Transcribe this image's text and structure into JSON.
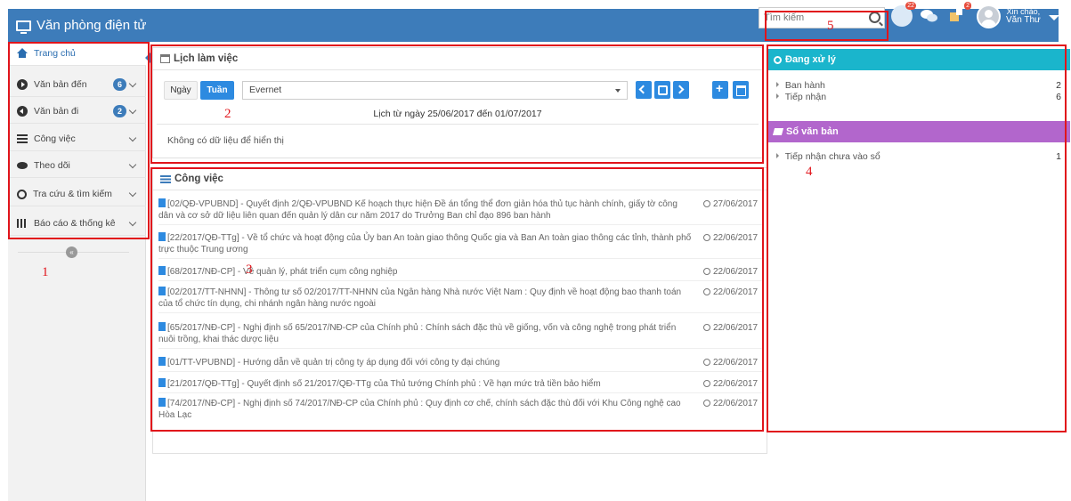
{
  "app": {
    "title": "Văn phòng điện tử",
    "brand_icon": "monitor-icon"
  },
  "header": {
    "search_placeholder": "Tìm kiếm",
    "notifications": [
      {
        "icon": "globe-icon",
        "badge": "22"
      },
      {
        "icon": "chat-icon",
        "badge": ""
      },
      {
        "icon": "puzzle-icon",
        "badge": "2"
      }
    ],
    "greeting": "Xin chào,",
    "user_name": "Văn Thư"
  },
  "sidebar": {
    "items": [
      {
        "label": "Trang chủ",
        "icon": "home-icon",
        "count": ""
      },
      {
        "label": "Văn bản đến",
        "icon": "arrow-circle-right-icon",
        "count": "6"
      },
      {
        "label": "Văn bản đi",
        "icon": "arrow-circle-left-icon",
        "count": "2"
      },
      {
        "label": "Công việc",
        "icon": "tasks-icon",
        "count": ""
      },
      {
        "label": "Theo dõi",
        "icon": "eye-icon",
        "count": ""
      },
      {
        "label": "Tra cứu & tìm kiếm",
        "icon": "search-icon",
        "count": ""
      },
      {
        "label": "Báo cáo & thống kê",
        "icon": "bar-chart-icon",
        "count": ""
      }
    ],
    "collapse_icon": "chevron-left-icon"
  },
  "calendar": {
    "title": "Lịch làm việc",
    "view_day": "Ngày",
    "view_week": "Tuần",
    "selected": "Evernet",
    "range": "Lịch từ ngày 25/06/2017 đến 01/07/2017",
    "empty": "Không có dữ liệu để hiển thị"
  },
  "tasks": {
    "title": "Công việc",
    "items": [
      {
        "text": "[02/QĐ-VPUBND] - Quyết định 2/QĐ-VPUBND Kế hoạch thực hiện Đề án tổng thể đơn giản hóa thủ tục hành chính, giấy tờ công dân và cơ sở dữ liệu liên quan đến quản lý dân cư năm 2017 do Trưởng Ban chỉ đạo 896 ban hành",
        "date": "27/06/2017"
      },
      {
        "text": "[22/2017/QĐ-TTg] - Về tổ chức và hoạt động của Ủy ban An toàn giao thông Quốc gia và Ban An toàn giao thông các tỉnh, thành phố trực thuộc Trung ương",
        "date": "22/06/2017"
      },
      {
        "text": "[68/2017/NĐ-CP] - Về quản lý, phát triển cụm công nghiệp",
        "date": "22/06/2017"
      },
      {
        "text": "[02/2017/TT-NHNN] - Thông tư số 02/2017/TT-NHNN của Ngân hàng Nhà nước Việt Nam : Quy định về hoạt động bao thanh toán của tổ chức tín dụng, chi nhánh ngân hàng nước ngoài",
        "date": "22/06/2017"
      },
      {
        "text": "[65/2017/NĐ-CP] - Nghị định số 65/2017/NĐ-CP của Chính phủ : Chính sách đặc thù về giống, vốn và công nghệ trong phát triển nuôi trồng, khai thác dược liệu",
        "date": "22/06/2017"
      },
      {
        "text": "[01/TT-VPUBND] - Hướng dẫn về quản trị công ty áp dụng đối với công ty đại chúng",
        "date": "22/06/2017"
      },
      {
        "text": "[21/2017/QĐ-TTg] - Quyết định số 21/2017/QĐ-TTg của Thủ tướng Chính phủ : Về hạn mức trả tiền bảo hiểm",
        "date": "22/06/2017"
      },
      {
        "text": "[74/2017/NĐ-CP] - Nghị định số 74/2017/NĐ-CP của Chính phủ : Quy định cơ chế, chính sách đặc thù đối với Khu Công nghệ cao Hòa Lạc",
        "date": "22/06/2017"
      }
    ]
  },
  "processing": {
    "title": "Đang xử lý",
    "color": "#1ab5cc",
    "items": [
      {
        "label": "Ban hành",
        "value": "2"
      },
      {
        "label": "Tiếp nhận",
        "value": "6"
      }
    ]
  },
  "registry": {
    "title": "Sổ văn bản",
    "color": "#b266cc",
    "items": [
      {
        "label": "Tiếp nhận chưa vào sổ",
        "value": "1"
      }
    ]
  },
  "annotations": {
    "n1": "1",
    "n2": "2",
    "n3": "3",
    "n4": "4",
    "n5": "5",
    "color": "#e1141b"
  },
  "colors": {
    "header": "#3d7cba",
    "accent": "#2d8ae0"
  }
}
